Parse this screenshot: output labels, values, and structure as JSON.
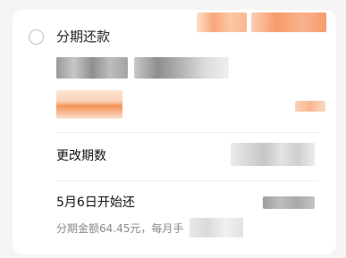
{
  "installment": {
    "option_label": "分期还款",
    "change_periods_label": "更改期数",
    "start_date_label": "5月6日开始还",
    "summary_text": "分期金额64.45元，每月手"
  },
  "colors": {
    "page_bg": "#f5f5f5",
    "card_bg": "#ffffff",
    "accent_orange": "#f7945a",
    "redacted_gray": "#b5b5b5"
  },
  "icons": {
    "radio": "radio-unchecked-icon"
  }
}
